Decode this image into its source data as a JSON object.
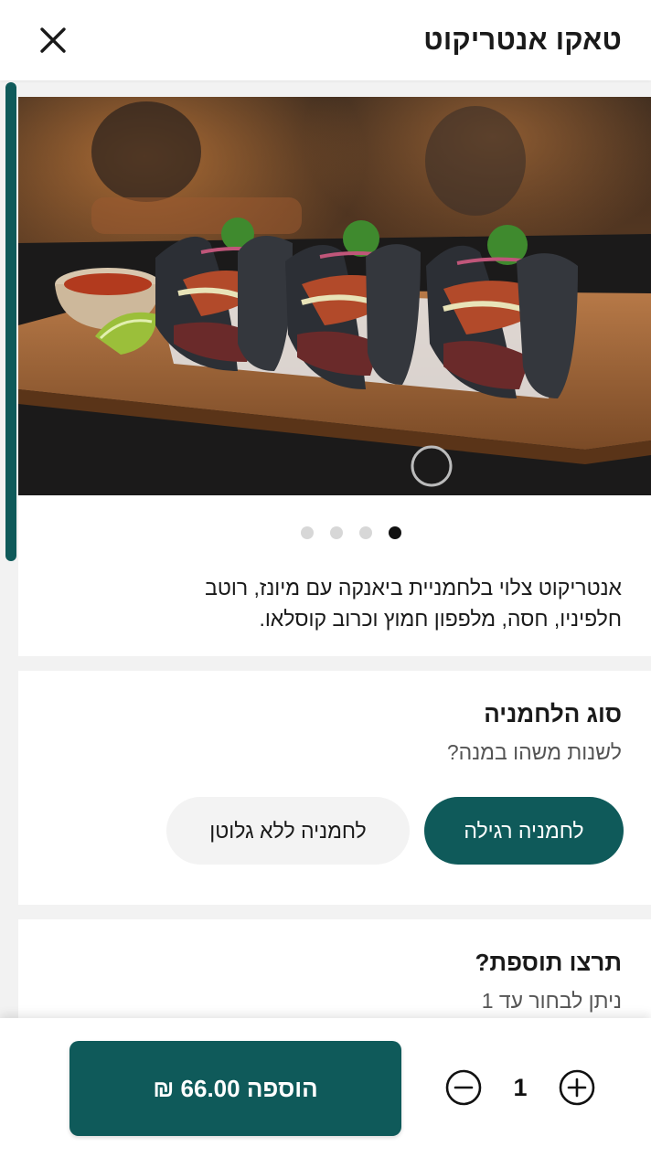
{
  "header": {
    "title": "טאקו אנטריקוט",
    "close_icon": "close-icon"
  },
  "gallery": {
    "total_images": 4,
    "active_index": 0
  },
  "description": {
    "line1": "אנטריקוט צלוי בלחמניית ביאנקה עם מיונז, רוטב",
    "line2": "חלפיניו, חסה, מלפפון חמוץ וכרוב קוסלאו."
  },
  "bread_section": {
    "title": "סוג הלחמניה",
    "subtitle": "לשנות משהו במנה?",
    "options": [
      {
        "label": "לחמניה רגילה",
        "selected": true
      },
      {
        "label": "לחמניה ללא גלוטן",
        "selected": false
      }
    ]
  },
  "extra_section": {
    "title": "תרצו תוספת?",
    "subtitle": "ניתן לבחור עד 1"
  },
  "footer": {
    "add_button_label": "הוספה 66.00 ₪",
    "quantity": "1",
    "minus_icon": "minus-circle-icon",
    "plus_icon": "plus-circle-icon"
  },
  "colors": {
    "accent": "#0f5a5a",
    "background": "#f2f2f2",
    "card": "#ffffff"
  }
}
